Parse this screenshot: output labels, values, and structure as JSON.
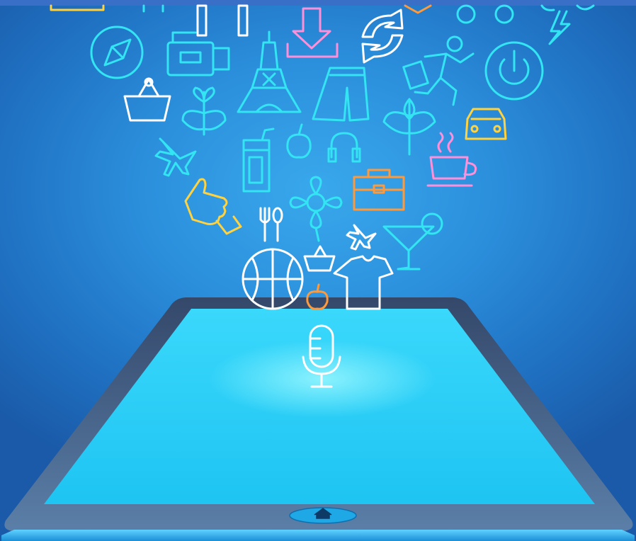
{
  "scene": {
    "colors": {
      "background": "#2b8fdc",
      "background_edge": "#1a5aa8",
      "tablet_frame": "#3f5d82",
      "tablet_screen": "#2ad0f8",
      "screen_glow": "#8ff6ff",
      "icon_cyan": "#33e4f2",
      "icon_white": "#ffffff",
      "icon_yellow": "#ffd23f",
      "icon_orange": "#ff9a3c",
      "icon_pink": "#ff8fd8",
      "home_button": "#1fa8e6"
    },
    "icons": [
      "compass-icon",
      "video-camera-icon",
      "eiffel-tower-icon",
      "download-icon",
      "refresh-icon",
      "running-man-icon",
      "power-icon",
      "lightning-icon",
      "shopping-basket-icon",
      "plant-icon",
      "shorts-icon",
      "leaf-branch-icon",
      "car-icon",
      "airplane-icon",
      "drink-carton-icon",
      "apple-icon",
      "headphones-icon",
      "briefcase-icon",
      "coffee-cup-icon",
      "thumbs-up-icon",
      "fork-spoon-icon",
      "flower-icon",
      "cocktail-glass-icon",
      "basketball-icon",
      "t-shirt-icon",
      "microphone-icon",
      "home-icon"
    ]
  }
}
